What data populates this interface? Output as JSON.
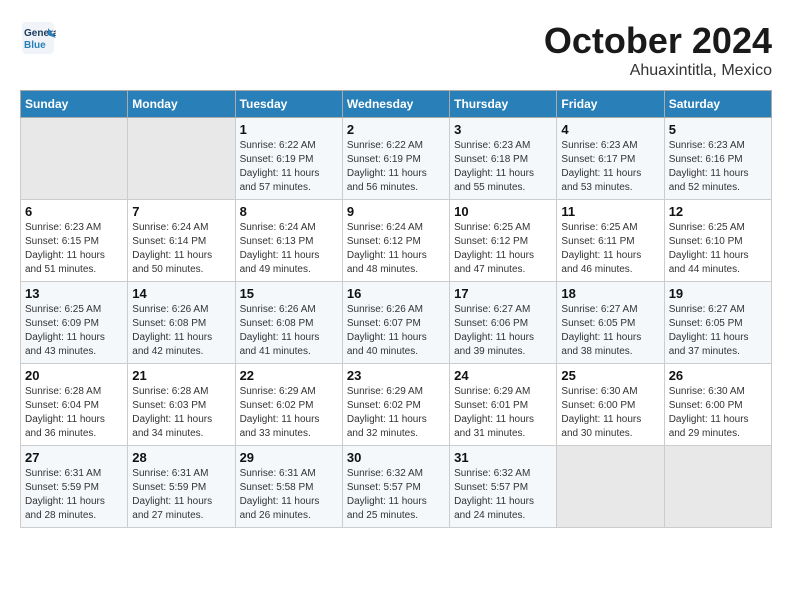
{
  "header": {
    "logo_line1": "General",
    "logo_line2": "Blue",
    "month": "October 2024",
    "location": "Ahuaxintitla, Mexico"
  },
  "weekdays": [
    "Sunday",
    "Monday",
    "Tuesday",
    "Wednesday",
    "Thursday",
    "Friday",
    "Saturday"
  ],
  "weeks": [
    [
      {
        "day": "",
        "info": ""
      },
      {
        "day": "",
        "info": ""
      },
      {
        "day": "1",
        "info": "Sunrise: 6:22 AM\nSunset: 6:19 PM\nDaylight: 11 hours and 57 minutes."
      },
      {
        "day": "2",
        "info": "Sunrise: 6:22 AM\nSunset: 6:19 PM\nDaylight: 11 hours and 56 minutes."
      },
      {
        "day": "3",
        "info": "Sunrise: 6:23 AM\nSunset: 6:18 PM\nDaylight: 11 hours and 55 minutes."
      },
      {
        "day": "4",
        "info": "Sunrise: 6:23 AM\nSunset: 6:17 PM\nDaylight: 11 hours and 53 minutes."
      },
      {
        "day": "5",
        "info": "Sunrise: 6:23 AM\nSunset: 6:16 PM\nDaylight: 11 hours and 52 minutes."
      }
    ],
    [
      {
        "day": "6",
        "info": "Sunrise: 6:23 AM\nSunset: 6:15 PM\nDaylight: 11 hours and 51 minutes."
      },
      {
        "day": "7",
        "info": "Sunrise: 6:24 AM\nSunset: 6:14 PM\nDaylight: 11 hours and 50 minutes."
      },
      {
        "day": "8",
        "info": "Sunrise: 6:24 AM\nSunset: 6:13 PM\nDaylight: 11 hours and 49 minutes."
      },
      {
        "day": "9",
        "info": "Sunrise: 6:24 AM\nSunset: 6:12 PM\nDaylight: 11 hours and 48 minutes."
      },
      {
        "day": "10",
        "info": "Sunrise: 6:25 AM\nSunset: 6:12 PM\nDaylight: 11 hours and 47 minutes."
      },
      {
        "day": "11",
        "info": "Sunrise: 6:25 AM\nSunset: 6:11 PM\nDaylight: 11 hours and 46 minutes."
      },
      {
        "day": "12",
        "info": "Sunrise: 6:25 AM\nSunset: 6:10 PM\nDaylight: 11 hours and 44 minutes."
      }
    ],
    [
      {
        "day": "13",
        "info": "Sunrise: 6:25 AM\nSunset: 6:09 PM\nDaylight: 11 hours and 43 minutes."
      },
      {
        "day": "14",
        "info": "Sunrise: 6:26 AM\nSunset: 6:08 PM\nDaylight: 11 hours and 42 minutes."
      },
      {
        "day": "15",
        "info": "Sunrise: 6:26 AM\nSunset: 6:08 PM\nDaylight: 11 hours and 41 minutes."
      },
      {
        "day": "16",
        "info": "Sunrise: 6:26 AM\nSunset: 6:07 PM\nDaylight: 11 hours and 40 minutes."
      },
      {
        "day": "17",
        "info": "Sunrise: 6:27 AM\nSunset: 6:06 PM\nDaylight: 11 hours and 39 minutes."
      },
      {
        "day": "18",
        "info": "Sunrise: 6:27 AM\nSunset: 6:05 PM\nDaylight: 11 hours and 38 minutes."
      },
      {
        "day": "19",
        "info": "Sunrise: 6:27 AM\nSunset: 6:05 PM\nDaylight: 11 hours and 37 minutes."
      }
    ],
    [
      {
        "day": "20",
        "info": "Sunrise: 6:28 AM\nSunset: 6:04 PM\nDaylight: 11 hours and 36 minutes."
      },
      {
        "day": "21",
        "info": "Sunrise: 6:28 AM\nSunset: 6:03 PM\nDaylight: 11 hours and 34 minutes."
      },
      {
        "day": "22",
        "info": "Sunrise: 6:29 AM\nSunset: 6:02 PM\nDaylight: 11 hours and 33 minutes."
      },
      {
        "day": "23",
        "info": "Sunrise: 6:29 AM\nSunset: 6:02 PM\nDaylight: 11 hours and 32 minutes."
      },
      {
        "day": "24",
        "info": "Sunrise: 6:29 AM\nSunset: 6:01 PM\nDaylight: 11 hours and 31 minutes."
      },
      {
        "day": "25",
        "info": "Sunrise: 6:30 AM\nSunset: 6:00 PM\nDaylight: 11 hours and 30 minutes."
      },
      {
        "day": "26",
        "info": "Sunrise: 6:30 AM\nSunset: 6:00 PM\nDaylight: 11 hours and 29 minutes."
      }
    ],
    [
      {
        "day": "27",
        "info": "Sunrise: 6:31 AM\nSunset: 5:59 PM\nDaylight: 11 hours and 28 minutes."
      },
      {
        "day": "28",
        "info": "Sunrise: 6:31 AM\nSunset: 5:59 PM\nDaylight: 11 hours and 27 minutes."
      },
      {
        "day": "29",
        "info": "Sunrise: 6:31 AM\nSunset: 5:58 PM\nDaylight: 11 hours and 26 minutes."
      },
      {
        "day": "30",
        "info": "Sunrise: 6:32 AM\nSunset: 5:57 PM\nDaylight: 11 hours and 25 minutes."
      },
      {
        "day": "31",
        "info": "Sunrise: 6:32 AM\nSunset: 5:57 PM\nDaylight: 11 hours and 24 minutes."
      },
      {
        "day": "",
        "info": ""
      },
      {
        "day": "",
        "info": ""
      }
    ]
  ]
}
